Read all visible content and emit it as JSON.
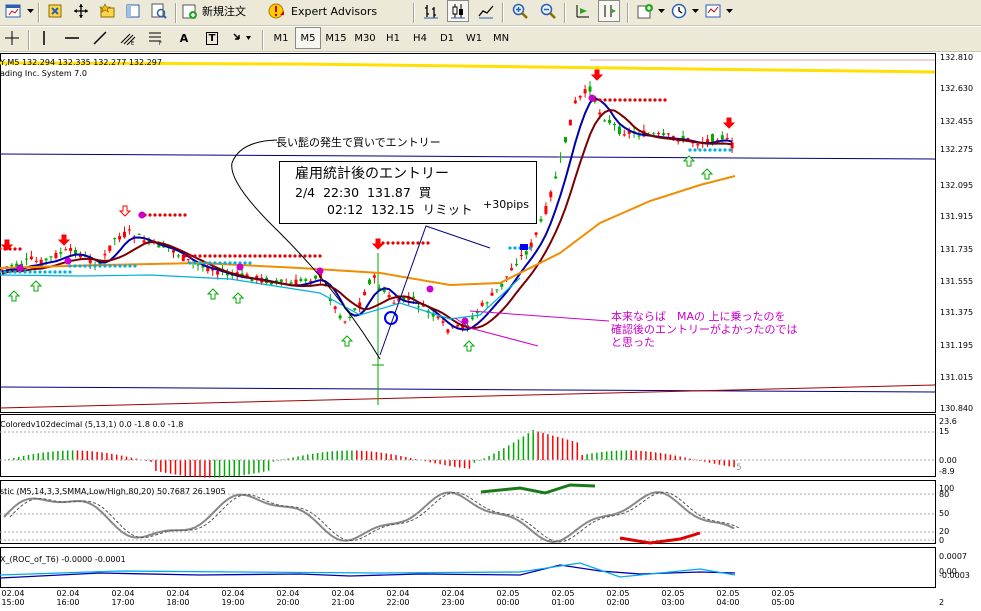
{
  "toolbar": {
    "new_order_label": "新規注文",
    "expert_advisors_label": "Expert Advisors",
    "timeframes": [
      "M1",
      "M5",
      "M15",
      "M30",
      "H1",
      "H4",
      "D1",
      "W1",
      "MN"
    ],
    "active_timeframe": "M5",
    "icons": [
      "new-chart-icon",
      "profiles-icon",
      "crosshair-icon",
      "favorites-icon",
      "navigator-icon",
      "data-window-icon",
      "new-order-icon",
      "expert-advisors-icon",
      "bar-chart-icon",
      "candlestick-icon",
      "line-chart-icon",
      "zoom-in-icon",
      "zoom-out-icon",
      "autoscroll-icon",
      "chart-shift-icon",
      "indicators-icon",
      "periods-icon",
      "templates-icon"
    ],
    "draw_tools": [
      "cursor-icon",
      "vertical-line-icon",
      "horizontal-line-icon",
      "trendline-icon",
      "fibo-channel-icon",
      "fibo-retracement-icon",
      "text-icon",
      "text-label-icon",
      "arrows-icon"
    ],
    "draw_text_a": "A",
    "draw_text_t": "T"
  },
  "chart": {
    "symbol_header": "Y,M5 132.294 132.335 132.277 132.297",
    "system_label": "ading Inc. System 7.0",
    "current_price": "132.297",
    "price_axis": [
      "132.810",
      "132.630",
      "132.455",
      "132.275",
      "132.095",
      "131.915",
      "131.735",
      "131.555",
      "131.375",
      "131.195",
      "131.015",
      "130.840"
    ],
    "colors": {
      "bull": "#00aa00",
      "bear": "#ff0000",
      "ma_fast": "#0000aa",
      "ma_mid": "#7a0000",
      "ma_slow": "#f08c00",
      "stop_dots": "#e00000",
      "cyan_dots": "#00b0e0",
      "magenta": "#cc00cc",
      "yellow_line": "#ffe000"
    },
    "annotations": {
      "whisker_note": "長い髭の発生で買いでエントリー",
      "box_title": "雇用統計後のエントリー",
      "box_line1": "2/4  22:30  131.87  買",
      "box_line2": "02:12  132.15  リミット",
      "box_pips": "+30pips",
      "comment": [
        "本来ならば　MAの 上に乗ったのを",
        "確認後のエントリーがよかったのでは",
        "と思った"
      ]
    }
  },
  "osc1": {
    "label": "Coloredv102decimal (5,13,1) 0.0 -1.8 0.0 -1.8",
    "axis": [
      "23.6",
      "15",
      "0.00",
      "-8.9"
    ],
    "marker": "5"
  },
  "osc2": {
    "label": "stic (M5,14,3,3,SMMA,Low/High,80,20) 50.7687 26.1905",
    "axis": [
      "100",
      "80",
      "50",
      "20",
      "0"
    ]
  },
  "osc3": {
    "label": "X_(ROC_of_T6) -0.0000 -0.0001",
    "axis": [
      "0.0007",
      "0.00",
      "-0.0003"
    ]
  },
  "time_axis": [
    [
      "02.04",
      "15:00"
    ],
    [
      "02.04",
      "16:00"
    ],
    [
      "02.04",
      "17:00"
    ],
    [
      "02.04",
      "18:00"
    ],
    [
      "02.04",
      "19:00"
    ],
    [
      "02.04",
      "20:00"
    ],
    [
      "02.04",
      "21:00"
    ],
    [
      "02.04",
      "22:00"
    ],
    [
      "02.04",
      "23:00"
    ],
    [
      "02.05",
      "00:00"
    ],
    [
      "02.05",
      "01:00"
    ],
    [
      "02.05",
      "02:00"
    ],
    [
      "02.05",
      "03:00"
    ],
    [
      "02.05",
      "04:00"
    ],
    [
      "02.05",
      "05:00"
    ]
  ],
  "time_axis_end_label": "2"
}
